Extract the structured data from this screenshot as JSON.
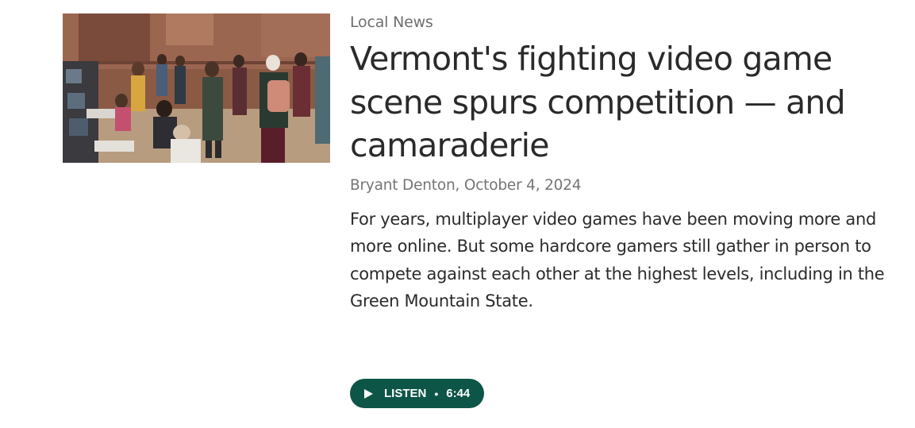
{
  "story": {
    "category": "Local News",
    "headline": "Vermont's fighting video game scene spurs competition — and camaraderie",
    "byline": "Bryant Denton, October 4, 2024",
    "summary": "For years, multiplayer video games have been moving more and more online. But some hardcore gamers still gather in person to compete against each other at the highest levels, including in the Green Mountain State.",
    "listen": {
      "label": "LISTEN",
      "separator": "•",
      "duration": "6:44"
    }
  },
  "colors": {
    "listen_button": "#0d5547",
    "headline": "#2a2a2a",
    "meta": "#757575"
  }
}
